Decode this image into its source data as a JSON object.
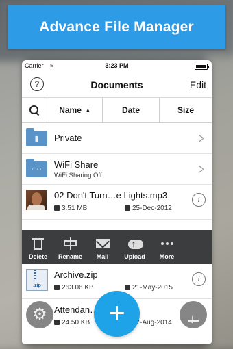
{
  "banner": {
    "text": "Advance File Manager"
  },
  "statusbar": {
    "carrier": "Carrier",
    "time": "3:23 PM",
    "battery_level": 0.9
  },
  "navbar": {
    "help_glyph": "?",
    "title": "Documents",
    "edit_label": "Edit"
  },
  "sortbar": {
    "name_label": "Name",
    "sort_arrow": "▲",
    "date_label": "Date",
    "size_label": "Size"
  },
  "rows": [
    {
      "type": "folder",
      "name": "Private",
      "icon": "lock-icon",
      "glyph": "🔒"
    },
    {
      "type": "folder",
      "name": "WiFi Share",
      "sub": "WiFi Sharing Off",
      "icon": "wifi-icon",
      "glyph": "((·))"
    },
    {
      "type": "file",
      "name": "02  Don't Turn…e Lights.mp3",
      "size": "3.51 MB",
      "date": "25-Dec-2012",
      "icon": "album-art"
    },
    {
      "type": "file",
      "name": "Archive.zip",
      "size": "263.06 KB",
      "date": "21-May-2015",
      "icon": "zip-icon",
      "thumb_label": ".zip"
    },
    {
      "type": "file",
      "name": "Attendan…odf",
      "size": "24.50 KB",
      "date": "27-Aug-2014",
      "icon": "document-icon"
    }
  ],
  "actions": [
    {
      "label": "Delete",
      "icon": "trash-icon"
    },
    {
      "label": "Rename",
      "icon": "rename-icon"
    },
    {
      "label": "Mail",
      "icon": "mail-icon"
    },
    {
      "label": "Upload",
      "icon": "cloud-upload-icon"
    },
    {
      "label": "More",
      "icon": "more-icon"
    }
  ],
  "collapse_glyph": "«",
  "fab": {
    "add_glyph": "+",
    "settings_glyph": "⚙"
  },
  "colors": {
    "banner": "#2e9be6",
    "fab_add": "#1ea3e8",
    "action_bar": "#3c3d3f"
  }
}
